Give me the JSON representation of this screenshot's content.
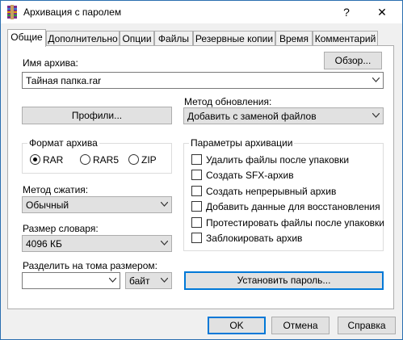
{
  "window": {
    "title": "Архивация с паролем",
    "help": "?",
    "close": "✕"
  },
  "tabs": [
    {
      "label": "Общие"
    },
    {
      "label": "Дополнительно"
    },
    {
      "label": "Опции"
    },
    {
      "label": "Файлы"
    },
    {
      "label": "Резервные копии"
    },
    {
      "label": "Время"
    },
    {
      "label": "Комментарий"
    }
  ],
  "archive": {
    "name_label": "Имя архива:",
    "browse": "Обзор...",
    "name_value": "Тайная папка.rar"
  },
  "profiles": "Профили...",
  "update": {
    "label": "Метод обновления:",
    "value": "Добавить с заменой файлов"
  },
  "format": {
    "title": "Формат архива",
    "options": [
      {
        "label": "RAR",
        "checked": true
      },
      {
        "label": "RAR5",
        "checked": false
      },
      {
        "label": "ZIP",
        "checked": false
      }
    ]
  },
  "compression": {
    "label": "Метод сжатия:",
    "value": "Обычный"
  },
  "dictionary": {
    "label": "Размер словаря:",
    "value": "4096 КБ"
  },
  "split": {
    "label": "Разделить на тома размером:",
    "value": "",
    "unit": "байт"
  },
  "params": {
    "title": "Параметры архивации",
    "items": [
      {
        "label": "Удалить файлы после упаковки",
        "checked": false
      },
      {
        "label": "Создать SFX-архив",
        "checked": false
      },
      {
        "label": "Создать непрерывный архив",
        "checked": false
      },
      {
        "label": "Добавить данные для восстановления",
        "checked": false
      },
      {
        "label": "Протестировать файлы после упаковки",
        "checked": false
      },
      {
        "label": "Заблокировать архив",
        "checked": false
      }
    ]
  },
  "set_password": "Установить пароль...",
  "footer": {
    "ok": "OK",
    "cancel": "Отмена",
    "help": "Справка"
  }
}
